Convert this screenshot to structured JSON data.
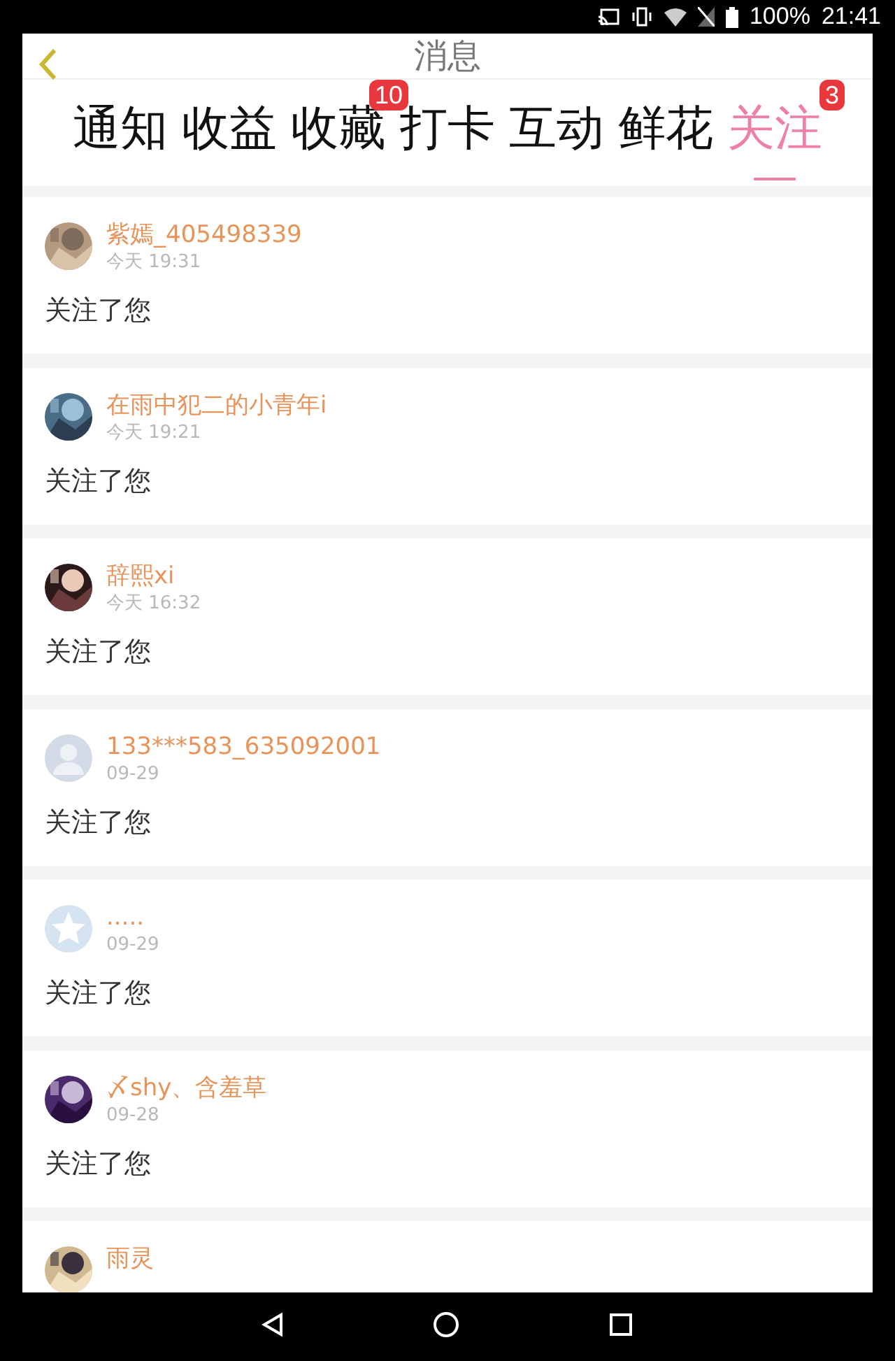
{
  "status_bar": {
    "battery": "100%",
    "time": "21:41"
  },
  "header": {
    "title": "消息"
  },
  "tabs": [
    {
      "label": "通知",
      "selected": false
    },
    {
      "label": "收益",
      "selected": false
    },
    {
      "label": "收藏",
      "selected": false,
      "badge": "10"
    },
    {
      "label": "打卡",
      "selected": false
    },
    {
      "label": "互动",
      "selected": false
    },
    {
      "label": "鲜花",
      "selected": false
    },
    {
      "label": "关注",
      "selected": true,
      "badge": "3"
    }
  ],
  "items": [
    {
      "name": "紫嫣_405498339",
      "time": "今天 19:31",
      "message": "关注了您"
    },
    {
      "name": "在雨中犯二的小青年i",
      "time": "今天 19:21",
      "message": "关注了您"
    },
    {
      "name": "辞熙xi",
      "time": "今天 16:32",
      "message": "关注了您"
    },
    {
      "avatar": {
        "kind": "default"
      },
      "name": "133***583_635092001",
      "time": "09-29",
      "message": "关注了您"
    },
    {
      "avatar": {
        "kind": "star"
      },
      "name": ".....",
      "time": "09-29",
      "message": "关注了您"
    },
    {
      "name": "〆shy、含羞草",
      "time": "09-28",
      "message": "关注了您"
    },
    {
      "name": "雨灵"
    }
  ]
}
